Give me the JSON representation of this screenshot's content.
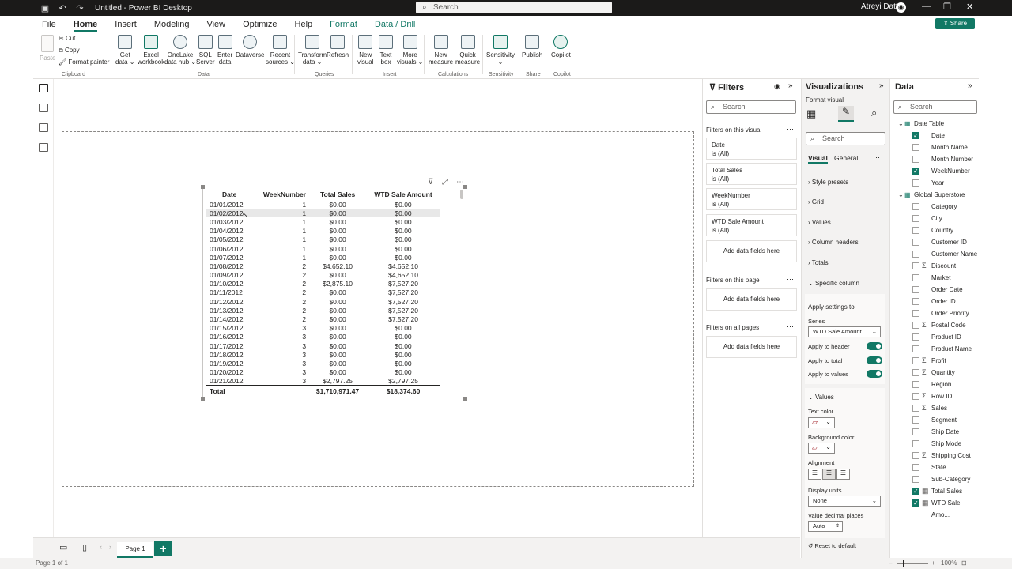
{
  "titlebar": {
    "title": "Untitled - Power BI Desktop",
    "search": "Search",
    "user": "Atreyi Datta"
  },
  "tabs": [
    "File",
    "Home",
    "Insert",
    "Modeling",
    "View",
    "Optimize",
    "Help",
    "Format",
    "Data / Drill"
  ],
  "share": "Share",
  "overlay_number": "24",
  "ribbon": {
    "clipboard": {
      "paste": "Paste",
      "cut": "Cut",
      "copy": "Copy",
      "format_painter": "Format painter",
      "group": "Clipboard"
    },
    "data_buttons": [
      {
        "l1": "Get",
        "l2": "data ⌄"
      },
      {
        "l1": "Excel",
        "l2": "workbook"
      },
      {
        "l1": "OneLake",
        "l2": "data hub ⌄"
      },
      {
        "l1": "SQL",
        "l2": "Server"
      },
      {
        "l1": "Enter",
        "l2": "data"
      },
      {
        "l1": "Dataverse",
        "l2": ""
      },
      {
        "l1": "Recent",
        "l2": "sources ⌄"
      }
    ],
    "data_group": "Data",
    "queries": [
      {
        "l1": "Transform",
        "l2": "data ⌄"
      },
      {
        "l1": "Refresh",
        "l2": ""
      }
    ],
    "queries_group": "Queries",
    "insert": [
      {
        "l1": "New",
        "l2": "visual"
      },
      {
        "l1": "Text",
        "l2": "box"
      },
      {
        "l1": "More",
        "l2": "visuals ⌄"
      }
    ],
    "insert_group": "Insert",
    "calc": [
      {
        "l1": "New",
        "l2": "measure"
      },
      {
        "l1": "Quick",
        "l2": "measure"
      }
    ],
    "calc_group": "Calculations",
    "sens": {
      "l1": "Sensitivity",
      "l2": "⌄"
    },
    "sens_group": "Sensitivity",
    "publish": "Publish",
    "share_group": "Share",
    "copilot": "Copilot",
    "copilot_group": "Copilot"
  },
  "table": {
    "headers": [
      "Date",
      "WeekNumber",
      "Total Sales",
      "WTD Sale Amount"
    ],
    "rows": [
      [
        "01/01/2012",
        "1",
        "$0.00",
        "$0.00"
      ],
      [
        "01/02/2012",
        "1",
        "$0.00",
        "$0.00"
      ],
      [
        "01/03/2012",
        "1",
        "$0.00",
        "$0.00"
      ],
      [
        "01/04/2012",
        "1",
        "$0.00",
        "$0.00"
      ],
      [
        "01/05/2012",
        "1",
        "$0.00",
        "$0.00"
      ],
      [
        "01/06/2012",
        "1",
        "$0.00",
        "$0.00"
      ],
      [
        "01/07/2012",
        "1",
        "$0.00",
        "$0.00"
      ],
      [
        "01/08/2012",
        "2",
        "$4,652.10",
        "$4,652.10"
      ],
      [
        "01/09/2012",
        "2",
        "$0.00",
        "$4,652.10"
      ],
      [
        "01/10/2012",
        "2",
        "$2,875.10",
        "$7,527.20"
      ],
      [
        "01/11/2012",
        "2",
        "$0.00",
        "$7,527.20"
      ],
      [
        "01/12/2012",
        "2",
        "$0.00",
        "$7,527.20"
      ],
      [
        "01/13/2012",
        "2",
        "$0.00",
        "$7,527.20"
      ],
      [
        "01/14/2012",
        "2",
        "$0.00",
        "$7,527.20"
      ],
      [
        "01/15/2012",
        "3",
        "$0.00",
        "$0.00"
      ],
      [
        "01/16/2012",
        "3",
        "$0.00",
        "$0.00"
      ],
      [
        "01/17/2012",
        "3",
        "$0.00",
        "$0.00"
      ],
      [
        "01/18/2012",
        "3",
        "$0.00",
        "$0.00"
      ],
      [
        "01/19/2012",
        "3",
        "$0.00",
        "$0.00"
      ],
      [
        "01/20/2012",
        "3",
        "$0.00",
        "$0.00"
      ],
      [
        "01/21/2012",
        "3",
        "$2,797.25",
        "$2,797.25"
      ]
    ],
    "total": [
      "Total",
      "",
      "$1,710,971.47",
      "$18,374.60"
    ]
  },
  "filters": {
    "title": "Filters",
    "search": "Search",
    "on_visual": "Filters on this visual",
    "cards": [
      {
        "name": "Date",
        "value": "is (All)"
      },
      {
        "name": "Total Sales",
        "value": "is (All)"
      },
      {
        "name": "WeekNumber",
        "value": "is (All)"
      },
      {
        "name": "WTD Sale Amount",
        "value": "is (All)"
      }
    ],
    "add": "Add data fields here",
    "on_page": "Filters on this page",
    "on_all": "Filters on all pages"
  },
  "viz": {
    "title": "Visualizations",
    "format_visual": "Format visual",
    "search": "Search",
    "tab_visual": "Visual",
    "tab_general": "General",
    "sections": [
      "Style presets",
      "Grid",
      "Values",
      "Column headers",
      "Totals",
      "Specific column"
    ],
    "apply_settings": "Apply settings to",
    "series_label": "Series",
    "series_value": "WTD Sale Amount",
    "apply_header": "Apply to header",
    "apply_total": "Apply to total",
    "apply_values": "Apply to values",
    "values_section": "Values",
    "text_color": "Text color",
    "bg_color": "Background color",
    "alignment": "Alignment",
    "display_units": "Display units",
    "display_units_value": "None",
    "decimal": "Value decimal places",
    "decimal_value": "Auto",
    "reset": "Reset to default"
  },
  "data": {
    "title": "Data",
    "search": "Search",
    "tables": [
      {
        "name": "Date Table",
        "fields": [
          {
            "name": "Date",
            "checked": true,
            "sigma": false
          },
          {
            "name": "Month Name",
            "checked": false,
            "sigma": false
          },
          {
            "name": "Month Number",
            "checked": false,
            "sigma": false
          },
          {
            "name": "WeekNumber",
            "checked": true,
            "sigma": false
          },
          {
            "name": "Year",
            "checked": false,
            "sigma": false
          }
        ]
      },
      {
        "name": "Global Superstore",
        "fields": [
          {
            "name": "Category",
            "checked": false,
            "sigma": false
          },
          {
            "name": "City",
            "checked": false,
            "sigma": false
          },
          {
            "name": "Country",
            "checked": false,
            "sigma": false
          },
          {
            "name": "Customer ID",
            "checked": false,
            "sigma": false
          },
          {
            "name": "Customer Name",
            "checked": false,
            "sigma": false
          },
          {
            "name": "Discount",
            "checked": false,
            "sigma": true
          },
          {
            "name": "Market",
            "checked": false,
            "sigma": false
          },
          {
            "name": "Order Date",
            "checked": false,
            "sigma": false
          },
          {
            "name": "Order ID",
            "checked": false,
            "sigma": false
          },
          {
            "name": "Order Priority",
            "checked": false,
            "sigma": false
          },
          {
            "name": "Postal Code",
            "checked": false,
            "sigma": true
          },
          {
            "name": "Product ID",
            "checked": false,
            "sigma": false
          },
          {
            "name": "Product Name",
            "checked": false,
            "sigma": false
          },
          {
            "name": "Profit",
            "checked": false,
            "sigma": true
          },
          {
            "name": "Quantity",
            "checked": false,
            "sigma": true
          },
          {
            "name": "Region",
            "checked": false,
            "sigma": false
          },
          {
            "name": "Row ID",
            "checked": false,
            "sigma": true
          },
          {
            "name": "Sales",
            "checked": false,
            "sigma": true
          },
          {
            "name": "Segment",
            "checked": false,
            "sigma": false
          },
          {
            "name": "Ship Date",
            "checked": false,
            "sigma": false
          },
          {
            "name": "Ship Mode",
            "checked": false,
            "sigma": false
          },
          {
            "name": "Shipping Cost",
            "checked": false,
            "sigma": true
          },
          {
            "name": "State",
            "checked": false,
            "sigma": false
          },
          {
            "name": "Sub-Category",
            "checked": false,
            "sigma": false
          },
          {
            "name": "Total Sales",
            "checked": true,
            "sigma": false,
            "calc": true
          },
          {
            "name": "WTD Sale Amo...",
            "checked": true,
            "sigma": false,
            "calc": true
          }
        ]
      }
    ]
  },
  "pages": {
    "tab": "Page 1",
    "add": "+"
  },
  "status": {
    "page": "Page 1 of 1",
    "zoom": "100%"
  },
  "colors": {
    "accent": "#117865",
    "titlebar": "#1b1a19"
  }
}
